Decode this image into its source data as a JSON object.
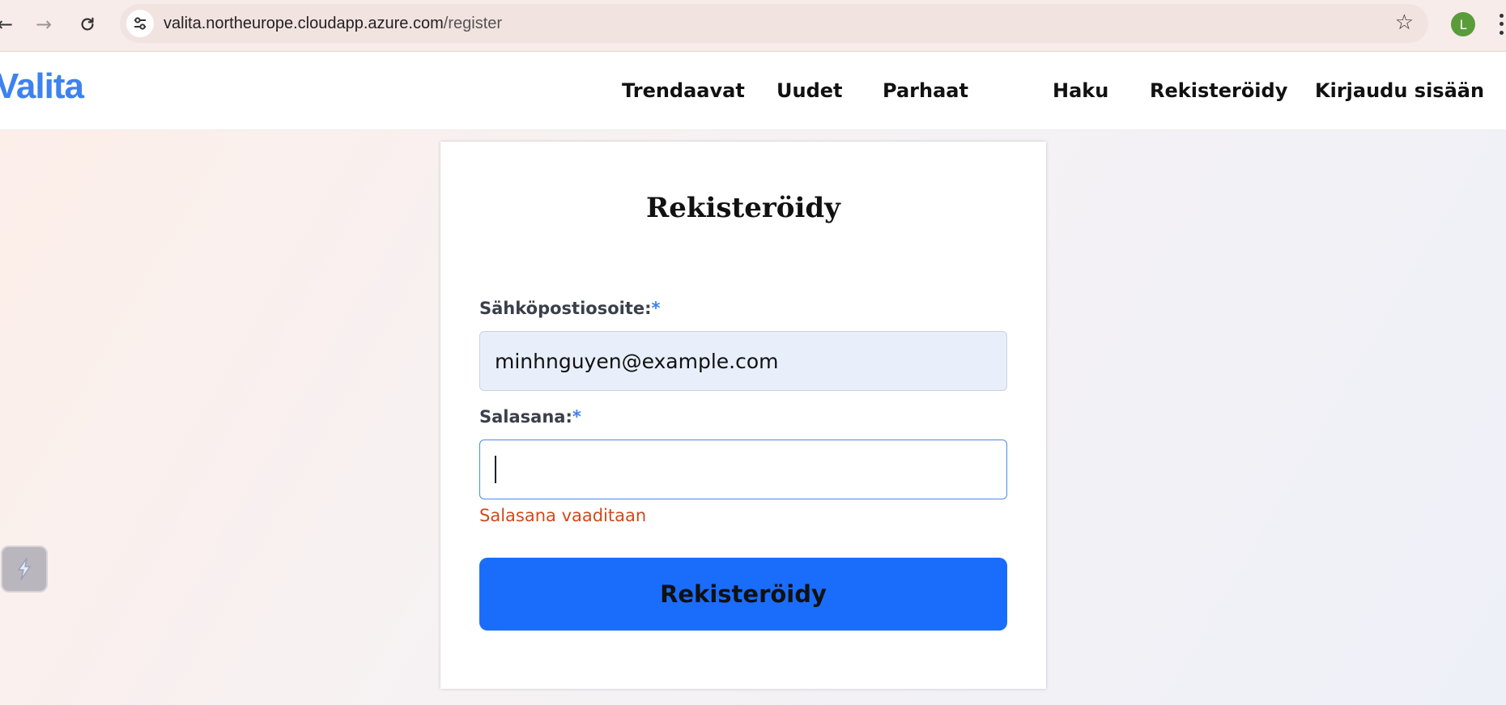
{
  "browser": {
    "back_icon": "arrow-left-icon",
    "forward_icon": "arrow-right-icon",
    "reload_icon": "reload-icon",
    "url_host": "valita.northeurope.cloudapp.azure.com",
    "url_path": "/register",
    "bookmark_icon": "star-icon",
    "profile_initial": "L",
    "profile_color": "#5a9c3a"
  },
  "header": {
    "brand": "Valita",
    "brand_color": "#3d82f0",
    "nav": {
      "trending": "Trendaavat",
      "new": "Uudet",
      "best": "Parhaat",
      "search": "Haku",
      "register": "Rekisteröidy",
      "login": "Kirjaudu sisään"
    }
  },
  "form": {
    "title": "Rekisteröidy",
    "email": {
      "label": "Sähköpostiosoite:",
      "required_mark": "*",
      "value": "minhnguyen@example.com"
    },
    "password": {
      "label": "Salasana:",
      "required_mark": "*",
      "value": "",
      "error": "Salasana vaaditaan"
    },
    "submit_label": "Rekisteröidy",
    "submit_color": "#1a6dfb",
    "error_color": "#d04a1c"
  },
  "widget": {
    "icon": "extension-lightning-icon"
  }
}
